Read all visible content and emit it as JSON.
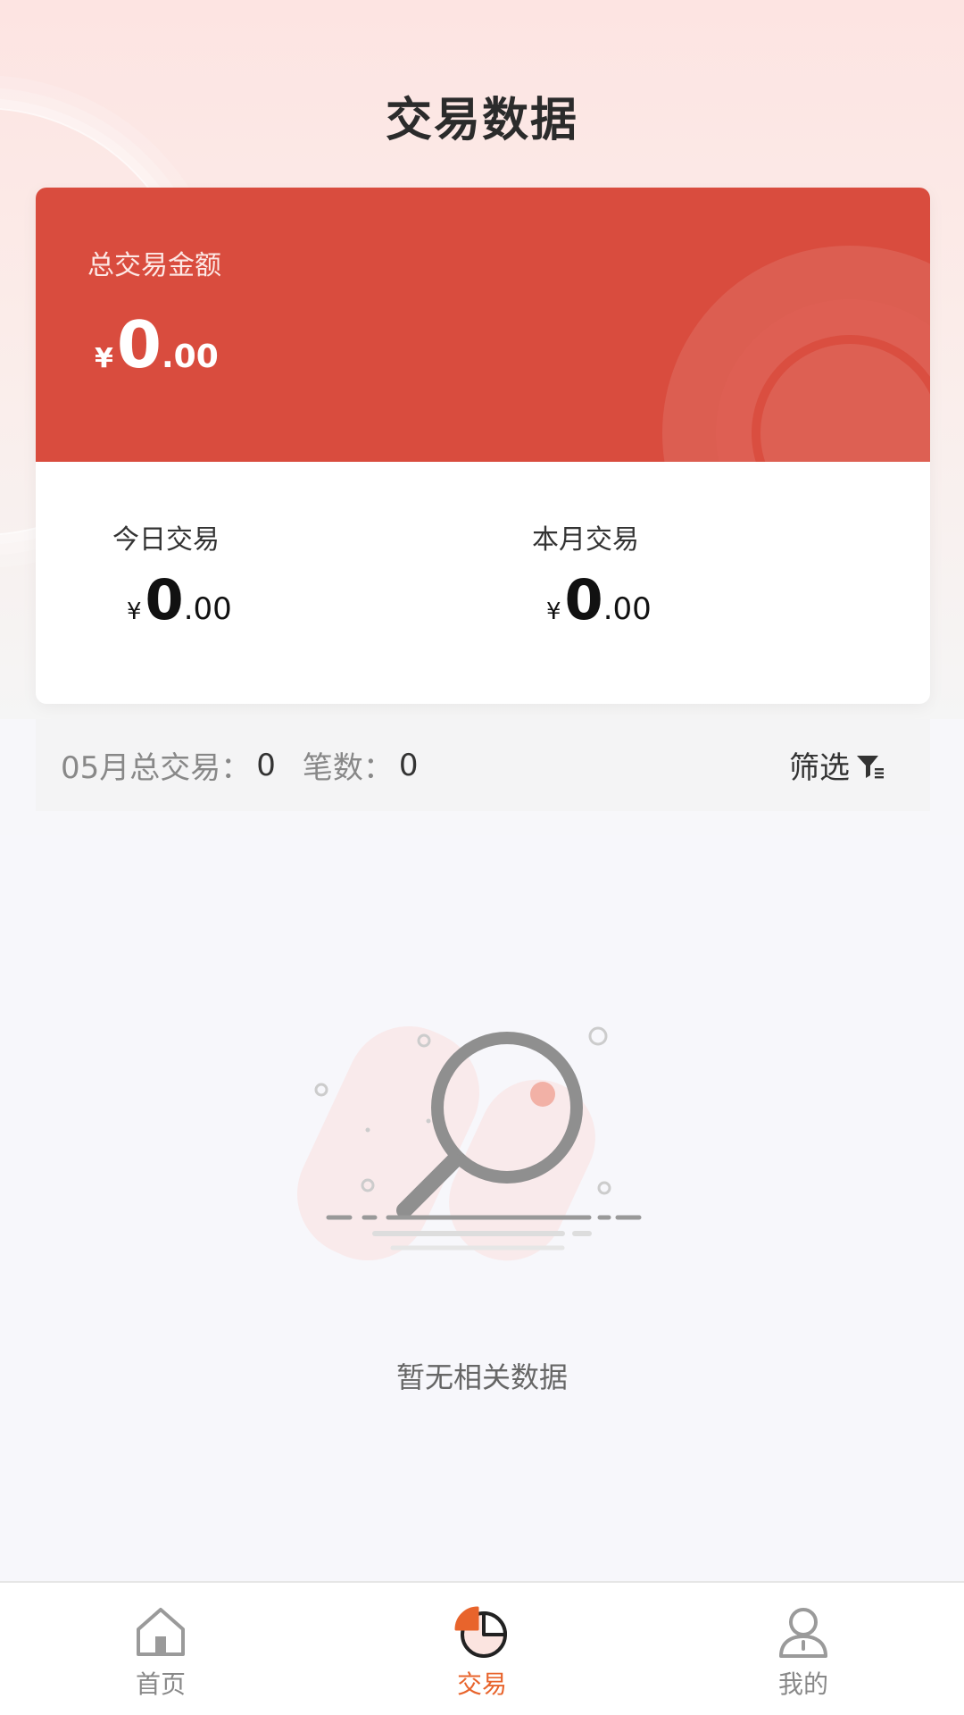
{
  "header": {
    "title": "交易数据"
  },
  "total": {
    "label": "总交易金额",
    "currency": "¥",
    "integer": "0",
    "decimal": ".00"
  },
  "today": {
    "label": "今日交易",
    "currency": "¥",
    "integer": "0",
    "decimal": ".00"
  },
  "month": {
    "label": "本月交易",
    "currency": "¥",
    "integer": "0",
    "decimal": ".00"
  },
  "summary": {
    "month_total_label": "05月总交易：",
    "month_total_value": "0",
    "count_label": "笔数：",
    "count_value": "0",
    "filter_label": "筛选"
  },
  "empty": {
    "message": "暂无相关数据"
  },
  "tabbar": {
    "items": [
      {
        "label": "首页",
        "icon": "home-icon"
      },
      {
        "label": "交易",
        "icon": "pie-chart-icon"
      },
      {
        "label": "我的",
        "icon": "user-icon"
      }
    ],
    "active_index": 1
  },
  "colors": {
    "primary_red": "#d94c3e",
    "active_tab": "#e8642c"
  }
}
